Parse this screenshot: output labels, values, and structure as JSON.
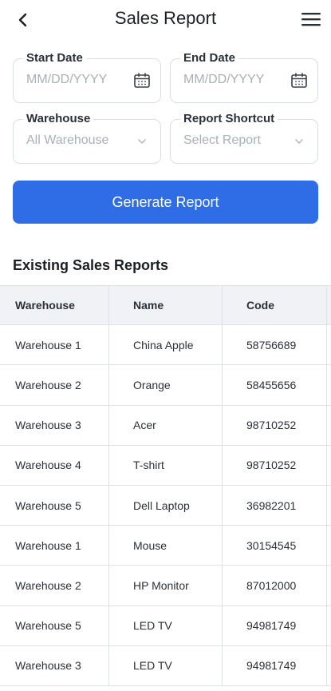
{
  "header": {
    "title": "Sales Report"
  },
  "filters": {
    "start_date": {
      "label": "Start Date",
      "placeholder": "MM/DD/YYYY"
    },
    "end_date": {
      "label": "End Date",
      "placeholder": "MM/DD/YYYY"
    },
    "warehouse": {
      "label": "Warehouse",
      "value": "All Warehouse"
    },
    "report_shortcut": {
      "label": "Report Shortcut",
      "value": "Select Report"
    }
  },
  "generate_button": "Generate Report",
  "section_title": "Existing Sales Reports",
  "table": {
    "columns": [
      "Warehouse",
      "Name",
      "Code"
    ],
    "rows": [
      [
        "Warehouse 1",
        "China Apple",
        "58756689"
      ],
      [
        "Warehouse 2",
        "Orange",
        "58455656"
      ],
      [
        "Warehouse 3",
        "Acer",
        "98710252"
      ],
      [
        "Warehouse 4",
        "T-shirt",
        "98710252"
      ],
      [
        "Warehouse 5",
        "Dell Laptop",
        "36982201"
      ],
      [
        "Warehouse 1",
        "Mouse",
        "30154545"
      ],
      [
        "Warehouse 2",
        "HP Monitor",
        "87012000"
      ],
      [
        "Warehouse 5",
        "LED TV",
        "94981749"
      ],
      [
        "Warehouse 3",
        "LED TV",
        "94981749"
      ]
    ]
  },
  "icons": {
    "back": "chevron-left-icon",
    "menu": "hamburger-menu-icon",
    "calendar": "calendar-icon",
    "dropdown": "chevron-down-icon"
  },
  "colors": {
    "primary": "#2f6de6",
    "border": "#d9dee5",
    "table_header_bg": "#f0f2f5"
  }
}
